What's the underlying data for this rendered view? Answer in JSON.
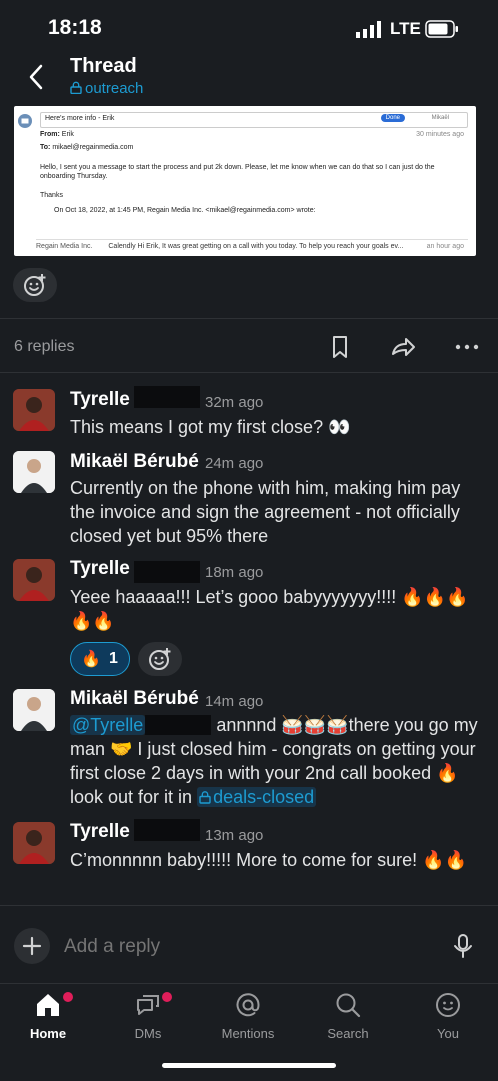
{
  "status_bar": {
    "time": "18:18",
    "network": "LTE"
  },
  "header": {
    "title": "Thread",
    "channel": "outreach"
  },
  "email_preview": {
    "subject": "Here's more info - Erik",
    "done_label": "Done",
    "sender_short": "Mikaël",
    "from_label": "From:",
    "from_name": "Erik",
    "received": "30 minutes ago",
    "to_label": "To:",
    "to_address": "mikael@regainmedia.com",
    "body_line1": "Hello, I sent you a message to start the process and put 2k down. Please, let me know when we can do that so I can just do the",
    "body_line2": "onboarding Thursday.",
    "thanks": "Thanks",
    "quote_line": "On Oct 18, 2022, at 1:45 PM, Regain Media Inc. <mikael@regainmedia.com> wrote:",
    "footer_sender": "Regain Media Inc.",
    "footer_snippet": "Calendly Hi Erik, It was great getting on a call with you today. To help you reach your goals ev...",
    "footer_time": "an hour ago"
  },
  "thread": {
    "replies_label": "6 replies"
  },
  "messages": [
    {
      "author": "Tyrelle",
      "time": "32m ago",
      "text": "This means I got my first close? 👀"
    },
    {
      "author": "Mikaël Bérubé",
      "time": "24m ago",
      "text": "Currently on the phone with him, making him pay the invoice and sign the agreement - not officially closed yet but 95% there"
    },
    {
      "author": "Tyrelle",
      "time": "18m ago",
      "text": "Yeee haaaaa!!! Let’s gooo babyyyyyyy!!!! 🔥🔥🔥🔥🔥",
      "reaction": {
        "emoji": "🔥",
        "count": "1"
      }
    },
    {
      "author": "Mikaël Bérubé",
      "time": "14m ago",
      "mention": "@Tyrelle",
      "text_a": "annnnd 🥁🥁🥁there you go my man 🤝 I just closed him - congrats on getting your first close 2 days in with your 2nd call booked 🔥 look out for it in",
      "channel": "deals-closed"
    },
    {
      "author": "Tyrelle",
      "time": "13m ago",
      "text": "C’monnnnn baby!!!!! More to come for sure! 🔥🔥"
    }
  ],
  "composer": {
    "placeholder": "Add a reply"
  },
  "tabs": [
    {
      "label": "Home"
    },
    {
      "label": "DMs"
    },
    {
      "label": "Mentions"
    },
    {
      "label": "Search"
    },
    {
      "label": "You"
    }
  ],
  "colors": {
    "background": "#1a1d21",
    "link": "#1d9bd1",
    "notification": "#e01e5a"
  }
}
